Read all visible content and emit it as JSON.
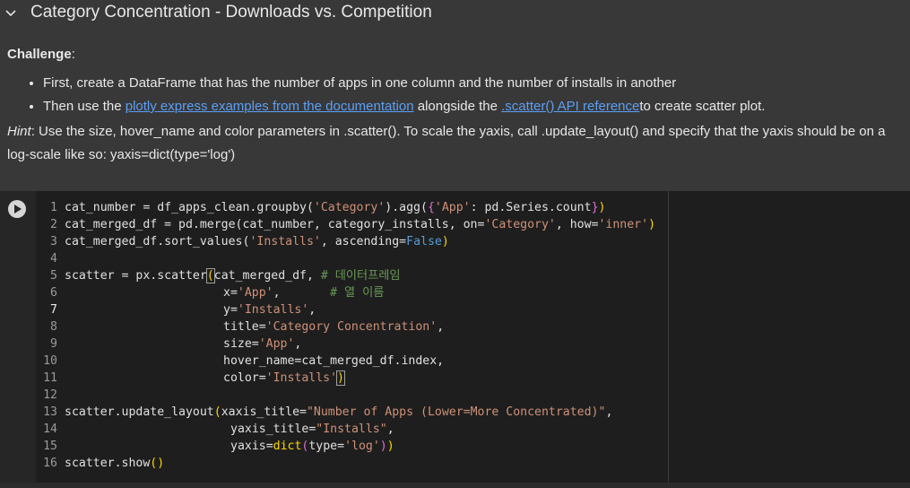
{
  "section": {
    "title": "Category Concentration - Downloads vs. Competition"
  },
  "text_cell": {
    "challenge_label": "Challenge",
    "challenge_colon": ":",
    "bullet1": "First, create a DataFrame that has the number of apps in one column and the number of installs in another",
    "bullet2_pre": "Then use the ",
    "bullet2_link1": "plotly express examples from the documentation",
    "bullet2_mid": " alongside the ",
    "bullet2_link2": ".scatter() API reference",
    "bullet2_post": "to create scatter plot.",
    "hint_label": "Hint",
    "hint_text": ": Use the size, hover_name and color parameters in .scatter(). To scale the yaxis, call .update_layout() and specify that the yaxis should be on a log-scale like so: yaxis=dict(type='log')"
  },
  "code": {
    "line_numbers": [
      "1",
      "2",
      "3",
      "4",
      "5",
      "6",
      "7",
      "8",
      "9",
      "10",
      "11",
      "12",
      "13",
      "14",
      "15",
      "16"
    ],
    "l1": {
      "a": "cat_number = df_apps_clean.groupby(",
      "b": "'Category'",
      "c": ").agg(",
      "d": "{",
      "e": "'App'",
      "f": ": pd.Series.count",
      "g": "}",
      "h": ")"
    },
    "l2": {
      "a": "cat_merged_df = pd.merge(cat_number, category_installs, on=",
      "b": "'Category'",
      "c": ", how=",
      "d": "'inner'",
      "e": ")"
    },
    "l3": {
      "a": "cat_merged_df.sort_values(",
      "b": "'Installs'",
      "c": ", ascending=",
      "d": "False",
      "e": ")"
    },
    "l5": {
      "a": "scatter = px.scatter",
      "b": "(",
      "c": "cat_merged_df, ",
      "d": "# 데이터프레임"
    },
    "l6": {
      "a": "x=",
      "b": "'App'",
      "c": ",       ",
      "d": "# 열 이름"
    },
    "l7": {
      "a": "y=",
      "b": "'Installs'",
      "c": ","
    },
    "l8": {
      "a": "title=",
      "b": "'Category Concentration'",
      "c": ","
    },
    "l9": {
      "a": "size=",
      "b": "'App'",
      "c": ","
    },
    "l10": {
      "a": "hover_name=cat_merged_df.index,"
    },
    "l11": {
      "a": "color=",
      "b": "'Installs'",
      "c": ")"
    },
    "l13": {
      "a": "scatter.update_layout",
      "b": "(",
      "c": "xaxis_title=",
      "d": "\"Number of Apps (Lower=More Concentrated)\"",
      "e": ","
    },
    "l14": {
      "a": "yaxis_title=",
      "b": "\"Installs\"",
      "c": ","
    },
    "l15": {
      "a": "yaxis=",
      "b": "dict",
      "c": "(",
      "d": "type=",
      "e": "'log'",
      "f": ")",
      "g": ")"
    },
    "l16": {
      "a": "scatter.show",
      "b": "()"
    }
  }
}
